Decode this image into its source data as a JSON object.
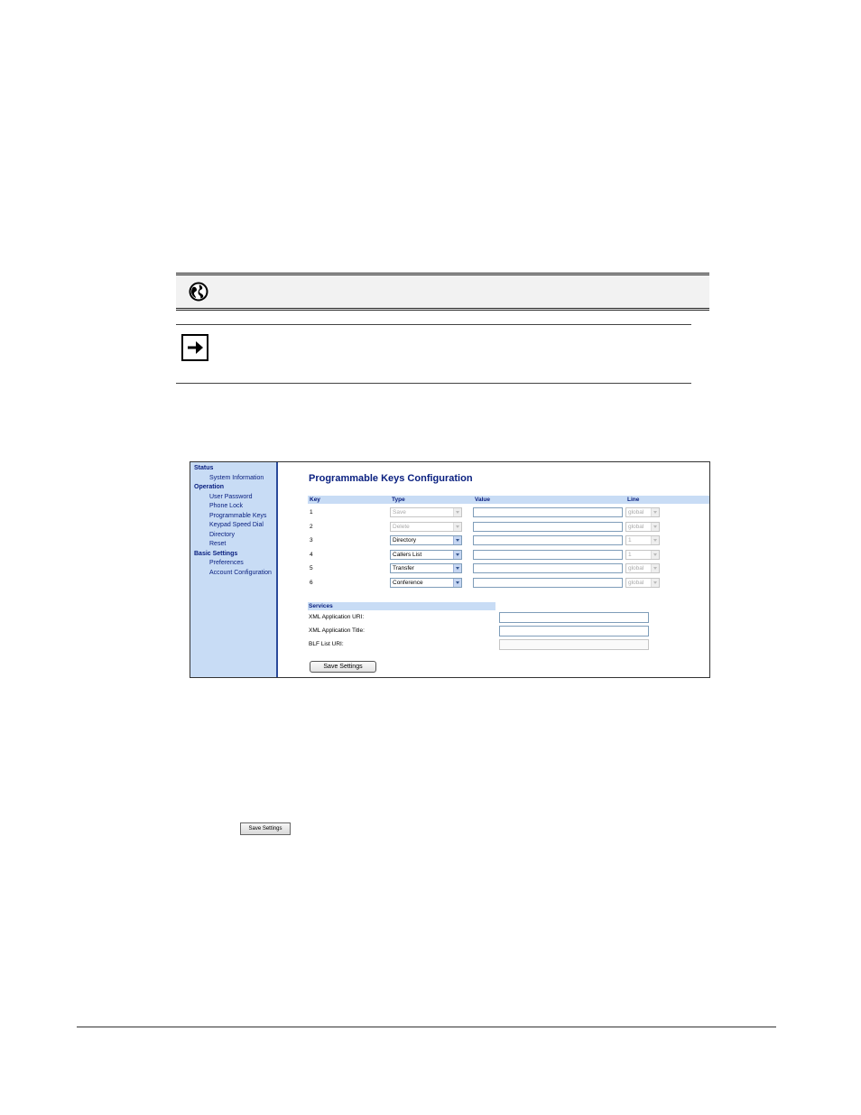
{
  "sidebar": {
    "sections": [
      {
        "heading": "Status",
        "items": [
          "System Information"
        ]
      },
      {
        "heading": "Operation",
        "items": [
          "User Password",
          "Phone Lock",
          "Programmable Keys",
          "Keypad Speed Dial",
          "Directory",
          "Reset"
        ]
      },
      {
        "heading": "Basic Settings",
        "items": [
          "Preferences",
          "Account Configuration"
        ]
      }
    ]
  },
  "page_title": "Programmable Keys Configuration",
  "columns": {
    "key": "Key",
    "type": "Type",
    "value": "Value",
    "line": "Line"
  },
  "keys": [
    {
      "num": "1",
      "type": "Save",
      "type_disabled": true,
      "line": "global"
    },
    {
      "num": "2",
      "type": "Delete",
      "type_disabled": true,
      "line": "global"
    },
    {
      "num": "3",
      "type": "Directory",
      "type_disabled": false,
      "line": "1"
    },
    {
      "num": "4",
      "type": "Callers List",
      "type_disabled": false,
      "line": "1"
    },
    {
      "num": "5",
      "type": "Transfer",
      "type_disabled": false,
      "line": "global"
    },
    {
      "num": "6",
      "type": "Conference",
      "type_disabled": false,
      "line": "global"
    }
  ],
  "services": {
    "heading": "Services",
    "xml_uri_label": "XML Application URI:",
    "xml_title_label": "XML Application Title:",
    "blf_label": "BLF List URI:"
  },
  "save_button": "Save Settings",
  "inline_button": "Save Settings",
  "icons": {
    "note": "globe-icon",
    "tip": "arrow-right-icon"
  }
}
